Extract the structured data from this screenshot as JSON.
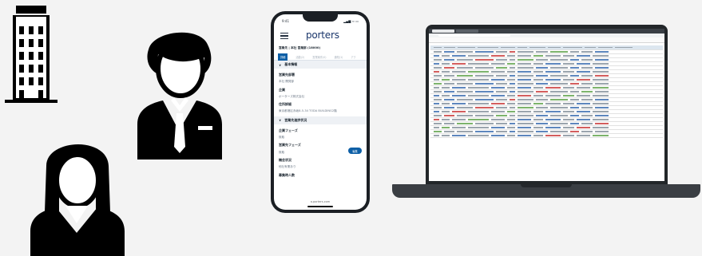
{
  "phone": {
    "status_time": "9:41",
    "status_icons": "▂▄▆ ≈ ▭",
    "logo": "porters",
    "record_title": "営業先 | 本社 営業部 (18000)",
    "tabs": [
      {
        "label": "詳細"
      },
      {
        "label": "活動(2)"
      },
      {
        "label": "営業案件(0)"
      },
      {
        "label": "通知(1)"
      },
      {
        "label": "アク"
      }
    ],
    "sections": {
      "basic_info": "基本情報",
      "sales_info": "営業先進捗状況"
    },
    "fields": {
      "dept_label": "営業先部署",
      "dept_value": "本社 開発部",
      "company_label": "企業",
      "company_value": "ポーターズ株式会社",
      "address_label": "住所詳細",
      "address_value": "東京都港区赤坂8-5-34 TODA BUILDING2階",
      "company_phase_label": "企業フェーズ",
      "company_phase_value": "既取",
      "sales_phase_label": "営業先フェーズ",
      "sales_phase_value": "既取",
      "edit_label": "編集",
      "contract_label": "機会状況",
      "contract_value": "他社有業あり",
      "staff_label": "募集時人数"
    },
    "footer_url": "a.porters.com"
  },
  "laptop": {
    "row_count": 22
  }
}
